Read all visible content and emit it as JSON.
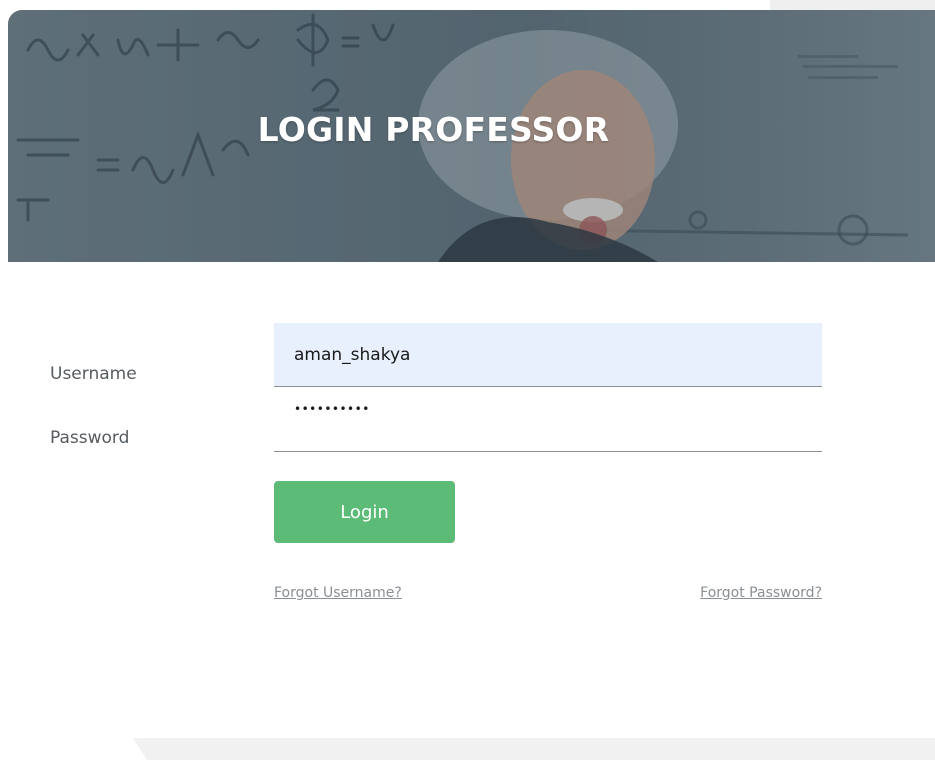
{
  "banner": {
    "title": "LOGIN PROFESSOR"
  },
  "form": {
    "username_label": "Username",
    "password_label": "Password",
    "username_value": "aman_shakya",
    "password_value": "••••••••••",
    "login_label": "Login"
  },
  "links": {
    "forgot_username": "Forgot Username?",
    "forgot_password": "Forgot Password?"
  },
  "colors": {
    "accent_button": "#5dbb78",
    "autofill_field": "#e8f0fe",
    "label_text": "#555b5f",
    "link_text": "#8a8f93"
  },
  "icons": {
    "banner_image": "chalkboard-portrait-image"
  }
}
